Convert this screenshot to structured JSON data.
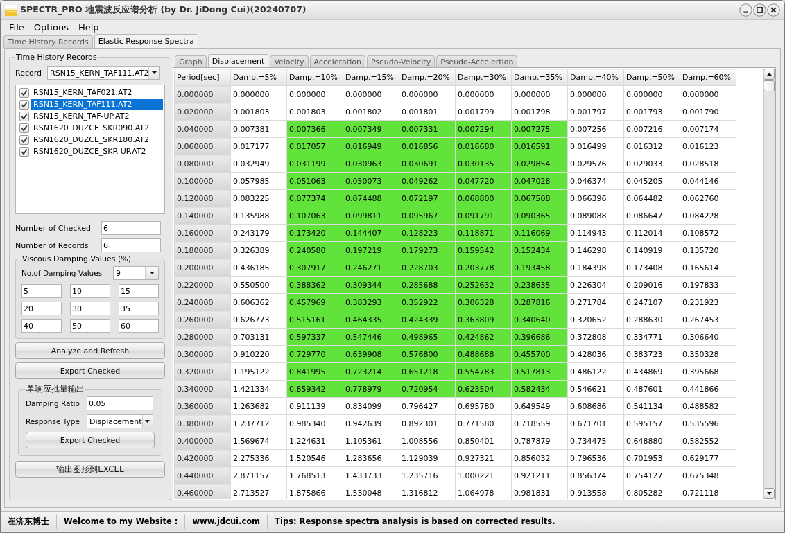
{
  "window": {
    "title": "SPECTR_PRO 地震波反应谱分析 (by Dr. JiDong Cui)(20240707)"
  },
  "menu": [
    "File",
    "Options",
    "Help"
  ],
  "tabs": [
    {
      "label": "Time History Records",
      "selected": false
    },
    {
      "label": "Elastic Response Spectra",
      "selected": true
    }
  ],
  "left_panel": {
    "title": "Time History Records",
    "record": {
      "label": "Record",
      "value": "RSN15_KERN_TAF111.AT2"
    },
    "records": [
      {
        "name": "RSN15_KERN_TAF021.AT2",
        "checked": true,
        "selected": false
      },
      {
        "name": "RSN15_KERN_TAF111.AT2",
        "checked": true,
        "selected": true
      },
      {
        "name": "RSN15_KERN_TAF-UP.AT2",
        "checked": true,
        "selected": false
      },
      {
        "name": "RSN1620_DUZCE_SKR090.AT2",
        "checked": true,
        "selected": false
      },
      {
        "name": "RSN1620_DUZCE_SKR180.AT2",
        "checked": true,
        "selected": false
      },
      {
        "name": "RSN1620_DUZCE_SKR-UP.AT2",
        "checked": true,
        "selected": false
      }
    ],
    "fields": [
      {
        "label": "Number of Checked",
        "value": "6"
      },
      {
        "label": "Number of Records",
        "value": "6"
      }
    ],
    "damping": {
      "title": "Viscous Damping Values (%)",
      "count": {
        "label": "No.of Damping Values",
        "value": "9"
      },
      "values": [
        "5",
        "10",
        "15",
        "20",
        "30",
        "35",
        "40",
        "50",
        "60"
      ]
    },
    "buttons": [
      "Analyze and Refresh",
      "Export Checked"
    ],
    "batch": {
      "title": "单响应批量输出",
      "damping_ratio": {
        "label": "Damping Ratio",
        "value": "0.05"
      },
      "response_type": {
        "label": "Response Type",
        "value": "Displacement"
      },
      "button": "Export Checked"
    },
    "excel_button": "输出图形到EXCEL"
  },
  "subtabs": [
    {
      "label": "Graph",
      "selected": false
    },
    {
      "label": "Displacement",
      "selected": true
    },
    {
      "label": "Velocity",
      "selected": false
    },
    {
      "label": "Acceleration",
      "selected": false
    },
    {
      "label": "Pseudo-Velocity",
      "selected": false
    },
    {
      "label": "Pseudo-Accelertion",
      "selected": false
    }
  ],
  "table": {
    "columns": [
      {
        "label": "Period[sec]",
        "highlight": false
      },
      {
        "label": "Damp.=5%",
        "highlight": false
      },
      {
        "label": "Damp.=10%",
        "highlight": true
      },
      {
        "label": "Damp.=15%",
        "highlight": true
      },
      {
        "label": "Damp.=20%",
        "highlight": true
      },
      {
        "label": "Damp.=30%",
        "highlight": true
      },
      {
        "label": "Damp.=35%",
        "highlight": true
      },
      {
        "label": "Damp.=40%",
        "highlight": false
      },
      {
        "label": "Damp.=50%",
        "highlight": false
      },
      {
        "label": "Damp.=60%",
        "highlight": false
      }
    ],
    "rows": [
      {
        "period": "0.000000",
        "values": [
          "0.000000",
          "0.000000",
          "0.000000",
          "0.000000",
          "0.000000",
          "0.000000",
          "0.000000",
          "0.000000",
          "0.000000"
        ],
        "highlighted": false
      },
      {
        "period": "0.020000",
        "values": [
          "0.001803",
          "0.001803",
          "0.001802",
          "0.001801",
          "0.001799",
          "0.001798",
          "0.001797",
          "0.001793",
          "0.001790"
        ],
        "highlighted": false
      },
      {
        "period": "0.040000",
        "values": [
          "0.007381",
          "0.007366",
          "0.007349",
          "0.007331",
          "0.007294",
          "0.007275",
          "0.007256",
          "0.007216",
          "0.007174"
        ],
        "highlighted": true
      },
      {
        "period": "0.060000",
        "values": [
          "0.017177",
          "0.017057",
          "0.016949",
          "0.016856",
          "0.016680",
          "0.016591",
          "0.016499",
          "0.016312",
          "0.016123"
        ],
        "highlighted": true
      },
      {
        "period": "0.080000",
        "values": [
          "0.032949",
          "0.031199",
          "0.030963",
          "0.030691",
          "0.030135",
          "0.029854",
          "0.029576",
          "0.029033",
          "0.028518"
        ],
        "highlighted": true
      },
      {
        "period": "0.100000",
        "values": [
          "0.057985",
          "0.051063",
          "0.050073",
          "0.049262",
          "0.047720",
          "0.047028",
          "0.046374",
          "0.045205",
          "0.044146"
        ],
        "highlighted": true
      },
      {
        "period": "0.120000",
        "values": [
          "0.083225",
          "0.077374",
          "0.074488",
          "0.072197",
          "0.068800",
          "0.067508",
          "0.066396",
          "0.064482",
          "0.062760"
        ],
        "highlighted": true
      },
      {
        "period": "0.140000",
        "values": [
          "0.135988",
          "0.107063",
          "0.099811",
          "0.095967",
          "0.091791",
          "0.090365",
          "0.089088",
          "0.086647",
          "0.084228"
        ],
        "highlighted": true
      },
      {
        "period": "0.160000",
        "values": [
          "0.243179",
          "0.173420",
          "0.144407",
          "0.128223",
          "0.118871",
          "0.116069",
          "0.114943",
          "0.112014",
          "0.108572"
        ],
        "highlighted": true
      },
      {
        "period": "0.180000",
        "values": [
          "0.326389",
          "0.240580",
          "0.197219",
          "0.179273",
          "0.159542",
          "0.152434",
          "0.146298",
          "0.140919",
          "0.135720"
        ],
        "highlighted": true
      },
      {
        "period": "0.200000",
        "values": [
          "0.436185",
          "0.307917",
          "0.246271",
          "0.228703",
          "0.203778",
          "0.193458",
          "0.184398",
          "0.173408",
          "0.165614"
        ],
        "highlighted": true
      },
      {
        "period": "0.220000",
        "values": [
          "0.550500",
          "0.388362",
          "0.309344",
          "0.285688",
          "0.252632",
          "0.238635",
          "0.226304",
          "0.209016",
          "0.197833"
        ],
        "highlighted": true
      },
      {
        "period": "0.240000",
        "values": [
          "0.606362",
          "0.457969",
          "0.383293",
          "0.352922",
          "0.306328",
          "0.287816",
          "0.271784",
          "0.247107",
          "0.231923"
        ],
        "highlighted": true
      },
      {
        "period": "0.260000",
        "values": [
          "0.626773",
          "0.515161",
          "0.464335",
          "0.424339",
          "0.363809",
          "0.340640",
          "0.320652",
          "0.288630",
          "0.267453"
        ],
        "highlighted": true
      },
      {
        "period": "0.280000",
        "values": [
          "0.703131",
          "0.597337",
          "0.547446",
          "0.498965",
          "0.424862",
          "0.396686",
          "0.372808",
          "0.334771",
          "0.306640"
        ],
        "highlighted": true
      },
      {
        "period": "0.300000",
        "values": [
          "0.910220",
          "0.729770",
          "0.639908",
          "0.576800",
          "0.488688",
          "0.455700",
          "0.428036",
          "0.383723",
          "0.350328"
        ],
        "highlighted": true
      },
      {
        "period": "0.320000",
        "values": [
          "1.195122",
          "0.841995",
          "0.723214",
          "0.651218",
          "0.554783",
          "0.517813",
          "0.486122",
          "0.434869",
          "0.395668"
        ],
        "highlighted": true
      },
      {
        "period": "0.340000",
        "values": [
          "1.421334",
          "0.859342",
          "0.778979",
          "0.720954",
          "0.623504",
          "0.582434",
          "0.546621",
          "0.487601",
          "0.441866"
        ],
        "highlighted": true
      },
      {
        "period": "0.360000",
        "values": [
          "1.263682",
          "0.911139",
          "0.834099",
          "0.796427",
          "0.695780",
          "0.649549",
          "0.608686",
          "0.541134",
          "0.488582"
        ],
        "highlighted": false
      },
      {
        "period": "0.380000",
        "values": [
          "1.237712",
          "0.985340",
          "0.942639",
          "0.892301",
          "0.771580",
          "0.718559",
          "0.671701",
          "0.595157",
          "0.535596"
        ],
        "highlighted": false
      },
      {
        "period": "0.400000",
        "values": [
          "1.569674",
          "1.224631",
          "1.105361",
          "1.008556",
          "0.850401",
          "0.787879",
          "0.734475",
          "0.648880",
          "0.582552"
        ],
        "highlighted": false
      },
      {
        "period": "0.420000",
        "values": [
          "2.275336",
          "1.520546",
          "1.283656",
          "1.129039",
          "0.927321",
          "0.856032",
          "0.796536",
          "0.701953",
          "0.629177"
        ],
        "highlighted": false
      },
      {
        "period": "0.440000",
        "values": [
          "2.871157",
          "1.768513",
          "1.433733",
          "1.235716",
          "1.000221",
          "0.921211",
          "0.856374",
          "0.754127",
          "0.675348"
        ],
        "highlighted": false
      },
      {
        "period": "0.460000",
        "values": [
          "2.713527",
          "1.875866",
          "1.530048",
          "1.316812",
          "1.064978",
          "0.981831",
          "0.913558",
          "0.805282",
          "0.721118"
        ],
        "highlighted": false
      }
    ]
  },
  "status_bar": [
    "崔济东博士",
    "Welcome to my Website :",
    "www.jdcui.com",
    "Tips: Response spectra analysis is based on corrected results."
  ]
}
